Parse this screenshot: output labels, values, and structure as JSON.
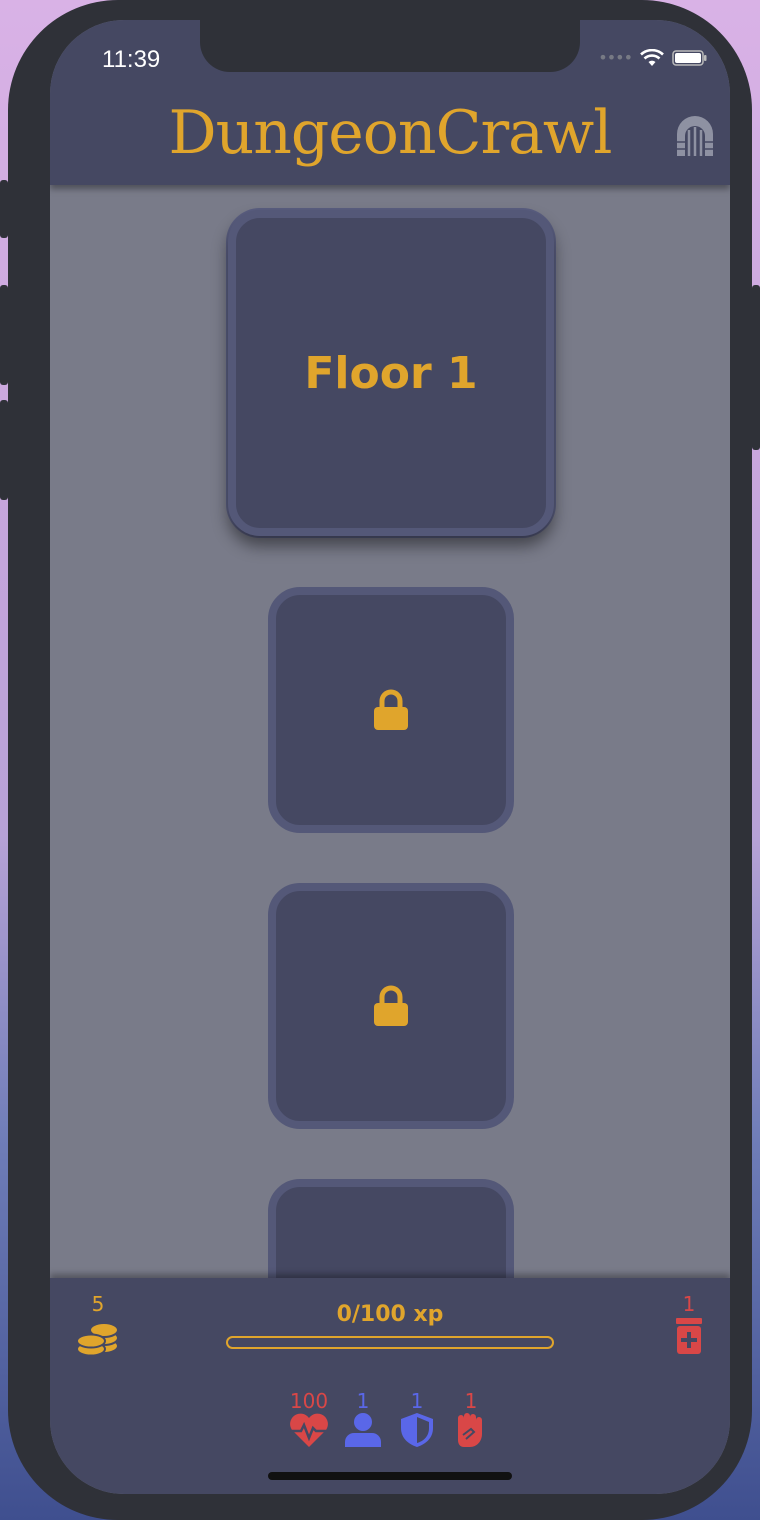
{
  "status_bar": {
    "time": "11:39"
  },
  "header": {
    "title": "DungeonCrawl",
    "menu_icon": "dungeon-gate-icon"
  },
  "floors": [
    {
      "label": "Floor 1",
      "locked": false
    },
    {
      "label": "",
      "locked": true,
      "icon": "lock-icon"
    },
    {
      "label": "",
      "locked": true,
      "icon": "lock-icon"
    },
    {
      "label": "",
      "locked": true
    }
  ],
  "footer": {
    "coins": {
      "count": "5",
      "icon": "coins-icon"
    },
    "xp": {
      "label": "0/100 xp",
      "progress": 0
    },
    "potions": {
      "count": "1",
      "icon": "potion-icon"
    },
    "stats": {
      "health": {
        "value": "100",
        "icon": "heart-pulse-icon",
        "color": "#d94747"
      },
      "level": {
        "value": "1",
        "icon": "user-icon",
        "color": "#5a67e8"
      },
      "defense": {
        "value": "1",
        "icon": "shield-icon",
        "color": "#5a67e8"
      },
      "attack": {
        "value": "1",
        "icon": "fist-icon",
        "color": "#d94747"
      }
    }
  },
  "colors": {
    "accent": "#e0a52c",
    "panel": "#454862",
    "background": "#797b89"
  }
}
